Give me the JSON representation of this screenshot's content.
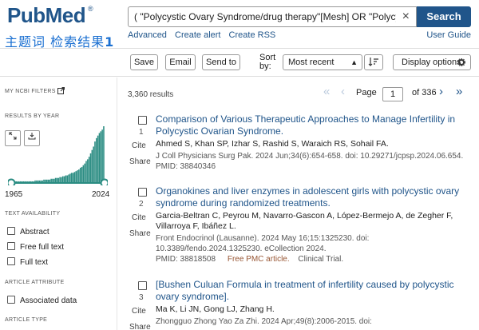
{
  "header": {
    "logo_main": "PubMed",
    "logo_reg": "®",
    "annotation_text": "主题词 检索结果",
    "annotation_num": "1",
    "search_query": "( \"Polycystic Ovary Syndrome/drug therapy\"[Mesh] OR \"Polycystic Ovary Syndrome\"",
    "clear_icon": "×",
    "search_label": "Search",
    "links": [
      "Advanced",
      "Create alert",
      "Create RSS"
    ],
    "user_guide": "User Guide"
  },
  "toolbar": {
    "save": "Save",
    "email": "Email",
    "send_to": "Send to",
    "sort_label": "Sort by:",
    "sort_value": "Most recent",
    "sort_dir_icon": "sort-icon",
    "display_options": "Display options"
  },
  "sidebar": {
    "filters_heading": "MY NCBI FILTERS",
    "results_by_year": "RESULTS BY YEAR",
    "year_start": "1965",
    "year_end": "2024",
    "histogram": [
      1,
      1,
      1,
      1,
      1,
      1,
      1,
      1,
      1,
      1,
      1,
      1,
      1,
      1,
      1,
      1,
      2,
      2,
      2,
      2,
      2,
      2,
      3,
      3,
      3,
      3,
      3,
      4,
      4,
      4,
      5,
      5,
      5,
      6,
      6,
      7,
      7,
      8,
      8,
      9,
      10,
      11,
      11,
      12,
      13,
      14,
      15,
      17,
      18,
      20,
      22,
      25,
      27,
      30,
      34,
      38,
      42,
      48,
      52,
      55,
      58,
      60,
      62,
      66
    ],
    "text_availability": "TEXT AVAILABILITY",
    "availability_options": [
      "Abstract",
      "Free full text",
      "Full text"
    ],
    "article_attribute": "ARTICLE ATTRIBUTE",
    "attribute_options": [
      "Associated data"
    ],
    "article_type": "ARTICLE TYPE",
    "colors": {
      "bar": "#2a8c82",
      "accent": "#20558a"
    }
  },
  "results": {
    "count": "3,360 results",
    "page_label": "Page",
    "page_value": "1",
    "page_of": "of 336",
    "items": [
      {
        "num": "1",
        "cite": "Cite",
        "share": "Share",
        "title": "Comparison of Various Therapeutic Approaches to Manage Infertility in Polycystic Ovarian Syndrome.",
        "authors": "Ahmed S, Khan SP, Izhar S, Rashid S, Waraich RS, Sohail FA.",
        "journal": "J Coll Physicians Surg Pak. 2024 Jun;34(6):654-658. doi: 10.29271/jcpsp.2024.06.654.",
        "pmid": "PMID: 38840346",
        "pmc": "",
        "ptype": ""
      },
      {
        "num": "2",
        "cite": "Cite",
        "share": "Share",
        "title": "Organokines and liver enzymes in adolescent girls with polycystic ovary syndrome during randomized treatments.",
        "authors": "Garcia-Beltran C, Peyrou M, Navarro-Gascon A, López-Bermejo A, de Zegher F, Villarroya F, Ibáñez L.",
        "journal": "Front Endocrinol (Lausanne). 2024 May 16;15:1325230. doi: 10.3389/fendo.2024.1325230. eCollection 2024.",
        "pmid": "PMID: 38818508",
        "pmc": "Free PMC article.",
        "ptype": "Clinical Trial."
      },
      {
        "num": "3",
        "cite": "Cite",
        "share": "Share",
        "title": "[Bushen Culuan Formula in treatment of infertility caused by polycystic ovary syndrome].",
        "authors": "Ma K, Li JN, Gong LJ, Zhang H.",
        "journal": "Zhongguo Zhong Yao Za Zhi. 2024 Apr;49(8):2006-2015. doi:",
        "pmid": "",
        "pmc": "",
        "ptype": ""
      }
    ]
  }
}
